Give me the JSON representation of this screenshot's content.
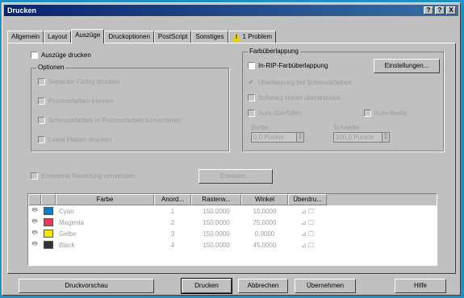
{
  "window": {
    "title": "Drucken"
  },
  "titlebar_buttons": [
    "?",
    "?",
    "X"
  ],
  "tabs": [
    "Allgemein",
    "Layout",
    "Auszüge",
    "Druckoptionen",
    "PostScript",
    "Sonstiges",
    "1 Problem"
  ],
  "active_tab": "Auszüge",
  "left": {
    "main_checkbox": "Auszüge drucken",
    "options_group": "Optionen",
    "options": [
      "Separate Farbig drucken",
      "Prozessfarben trennen",
      "Schmuckfarben in Prozessfarben konvertieren",
      "Leere Platten drucken"
    ]
  },
  "right": {
    "group_title": "Farbüberlappung",
    "trap_checkbox": "In-RIP-Farbüberlappung",
    "settings_button": "Einstellungen...",
    "options": [
      "Überlappung bei Schmuckfarben",
      "Schwarz immer überdrucken",
      "Auto-überfüllen",
      "Auto-Breite"
    ],
    "width_label": "Breite:",
    "width_value": "0,0 Punkte",
    "threshold_label": "Schwelle:",
    "threshold_value": "100,0 Punkte"
  },
  "halftone": {
    "checkbox": "Erweiterte Rasterung verwenden",
    "button": "Erweitert..."
  },
  "table": {
    "headers": [
      "",
      "",
      "Farbe",
      "Anord...",
      "Rasterw...",
      "Winkel",
      "Überdru..."
    ],
    "rows": [
      {
        "name": "Cyan",
        "color": "#0a7ec2",
        "order": "1",
        "freq": "150,0000",
        "angle": "15,0000"
      },
      {
        "name": "Magenta",
        "color": "#e63c5a",
        "order": "2",
        "freq": "150,0000",
        "angle": "75,0000"
      },
      {
        "name": "Gelbe",
        "color": "#f4e400",
        "order": "3",
        "freq": "150,0000",
        "angle": "0,0000"
      },
      {
        "name": "Black",
        "color": "#333333",
        "order": "4",
        "freq": "150,0000",
        "angle": "45,0000"
      }
    ]
  },
  "buttons": {
    "preview": "Druckvorschau",
    "print": "Drucken",
    "cancel": "Abbrechen",
    "apply": "Übernehmen",
    "help": "Hilfe"
  }
}
